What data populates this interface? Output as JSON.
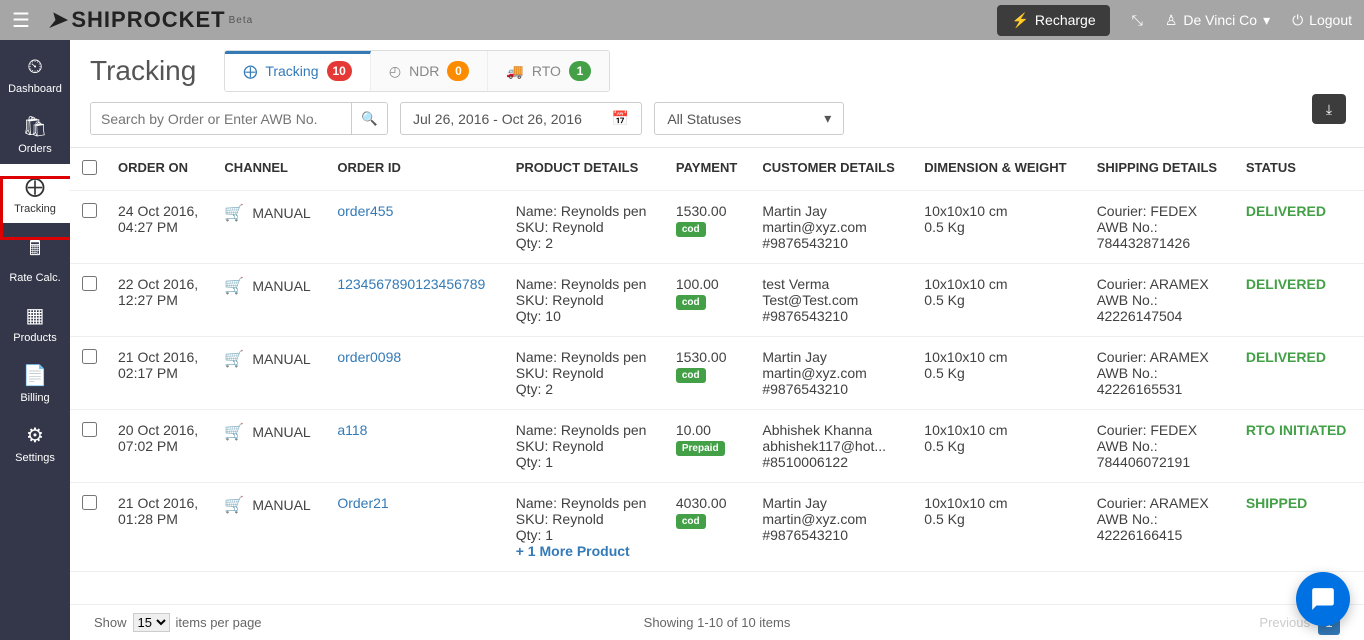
{
  "topbar": {
    "logo_text": "SHIPROCKET",
    "logo_beta": "Beta",
    "recharge_label": "Recharge",
    "user_label": "De Vinci Co",
    "logout_label": "Logout"
  },
  "sidenav": {
    "dashboard": "Dashboard",
    "orders": "Orders",
    "tracking": "Tracking",
    "rate_calc": "Rate Calc.",
    "products": "Products",
    "billing": "Billing",
    "settings": "Settings"
  },
  "page": {
    "title": "Tracking",
    "search_placeholder": "Search by Order or Enter AWB No.",
    "date_range": "Jul 26, 2016 - Oct 26, 2016",
    "status_filter": "All Statuses"
  },
  "tabs": {
    "tracking_label": "Tracking",
    "tracking_count": "10",
    "ndr_label": "NDR",
    "ndr_count": "0",
    "rto_label": "RTO",
    "rto_count": "1"
  },
  "cols": {
    "order_on": "ORDER ON",
    "channel": "CHANNEL",
    "order_id": "ORDER ID",
    "product": "PRODUCT DETAILS",
    "payment": "PAYMENT",
    "customer": "CUSTOMER DETAILS",
    "dim": "DIMENSION & WEIGHT",
    "shipping": "SHIPPING DETAILS",
    "status": "STATUS"
  },
  "channel_label": "MANUAL",
  "pay_labels": {
    "cod": "cod",
    "prepaid": "Prepaid"
  },
  "rows": [
    {
      "order_on_l1": "24 Oct 2016,",
      "order_on_l2": "04:27 PM",
      "order_id": "order455",
      "prod_l1": "Name: Reynolds pen",
      "prod_l2": "SKU: Reynold",
      "prod_l3": "Qty: 2",
      "prod_more": "",
      "pay_amount": "1530.00",
      "pay_type": "cod",
      "cust_l1": "Martin Jay",
      "cust_l2": "martin@xyz.com",
      "cust_l3": "#9876543210",
      "dim_l1": "10x10x10 cm",
      "dim_l2": "0.5 Kg",
      "ship_l1": "Courier: FEDEX",
      "ship_l2": "AWB No.:",
      "ship_l3": "784432871426",
      "status": "DELIVERED",
      "status_class": "status-delivered"
    },
    {
      "order_on_l1": "22 Oct 2016,",
      "order_on_l2": "12:27 PM",
      "order_id": "1234567890123456789",
      "prod_l1": "Name: Reynolds pen",
      "prod_l2": "SKU: Reynold",
      "prod_l3": "Qty: 10",
      "prod_more": "",
      "pay_amount": "100.00",
      "pay_type": "cod",
      "cust_l1": "test Verma",
      "cust_l2": "Test@Test.com",
      "cust_l3": "#9876543210",
      "dim_l1": "10x10x10 cm",
      "dim_l2": "0.5 Kg",
      "ship_l1": "Courier: ARAMEX",
      "ship_l2": "AWB No.:",
      "ship_l3": "42226147504",
      "status": "DELIVERED",
      "status_class": "status-delivered"
    },
    {
      "order_on_l1": "21 Oct 2016,",
      "order_on_l2": "02:17 PM",
      "order_id": "order0098",
      "prod_l1": "Name: Reynolds pen",
      "prod_l2": "SKU: Reynold",
      "prod_l3": "Qty: 2",
      "prod_more": "",
      "pay_amount": "1530.00",
      "pay_type": "cod",
      "cust_l1": "Martin Jay",
      "cust_l2": "martin@xyz.com",
      "cust_l3": "#9876543210",
      "dim_l1": "10x10x10 cm",
      "dim_l2": "0.5 Kg",
      "ship_l1": "Courier: ARAMEX",
      "ship_l2": "AWB No.:",
      "ship_l3": "42226165531",
      "status": "DELIVERED",
      "status_class": "status-delivered"
    },
    {
      "order_on_l1": "20 Oct 2016,",
      "order_on_l2": "07:02 PM",
      "order_id": "a118",
      "prod_l1": "Name: Reynolds pen",
      "prod_l2": "SKU: Reynold",
      "prod_l3": "Qty: 1",
      "prod_more": "",
      "pay_amount": "10.00",
      "pay_type": "prepaid",
      "cust_l1": "Abhishek Khanna",
      "cust_l2": "abhishek117@hot...",
      "cust_l3": "#8510006122",
      "dim_l1": "10x10x10 cm",
      "dim_l2": "0.5 Kg",
      "ship_l1": "Courier: FEDEX",
      "ship_l2": "AWB No.:",
      "ship_l3": "784406072191",
      "status": "RTO INITIATED",
      "status_class": "status-rto"
    },
    {
      "order_on_l1": "21 Oct 2016,",
      "order_on_l2": "01:28 PM",
      "order_id": "Order21",
      "prod_l1": "Name: Reynolds pen",
      "prod_l2": "SKU: Reynold",
      "prod_l3": "Qty: 1",
      "prod_more": "+ 1 More Product",
      "pay_amount": "4030.00",
      "pay_type": "cod",
      "cust_l1": "Martin Jay",
      "cust_l2": "martin@xyz.com",
      "cust_l3": "#9876543210",
      "dim_l1": "10x10x10 cm",
      "dim_l2": "0.5 Kg",
      "ship_l1": "Courier: ARAMEX",
      "ship_l2": "AWB No.:",
      "ship_l3": "42226166415",
      "status": "SHIPPED",
      "status_class": "status-shipped"
    }
  ],
  "footer": {
    "show": "Show",
    "per_page_value": "15",
    "per_page_suffix": "items per page",
    "showing": "Showing 1-10 of 10 items",
    "previous": "Previous",
    "page": "1"
  }
}
